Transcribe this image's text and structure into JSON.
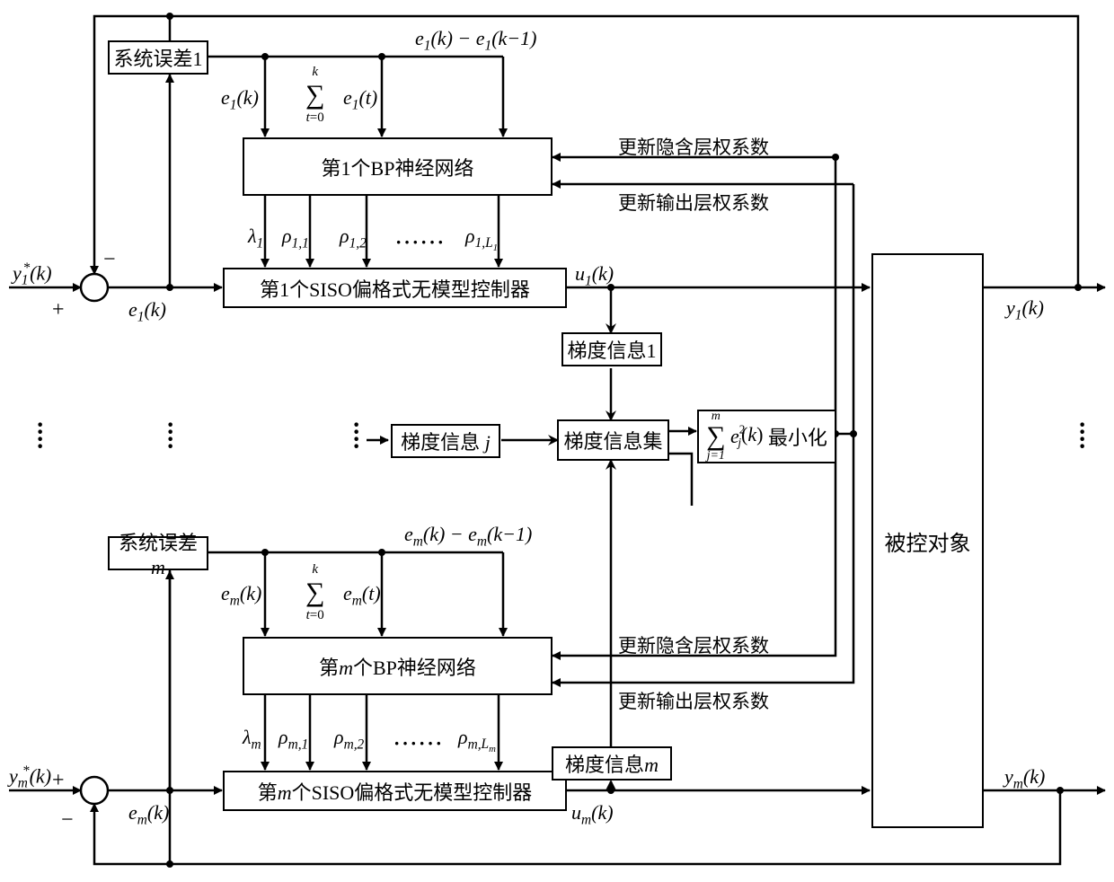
{
  "inputs": {
    "y1_ref": "y₁*(k)",
    "ym_ref": "yₘ*(k)"
  },
  "errors": {
    "e1": "e₁(k)",
    "em": "eₘ(k)"
  },
  "sys_error_1": "系统误差1",
  "sys_error_m_prefix": "系统误差",
  "sys_error_m_var": "m",
  "bp1": "第1个BP神经网络",
  "bpm_prefix": "第",
  "bpm_var": "m",
  "bpm_suffix": "个BP神经网络",
  "siso1": "第1个SISO偏格式无模型控制器",
  "sisom_prefix": "第",
  "sisom_var": "m",
  "sisom_suffix": "个SISO偏格式无模型控制器",
  "grad1": "梯度信息1",
  "gradj_prefix": "梯度信息 ",
  "gradj_var": "j",
  "gradm_prefix": "梯度信息",
  "gradm_var": "m",
  "gradset": "梯度信息集",
  "minimizer_suffix": "最小化",
  "controlled_object": "被控对象",
  "update_hidden": "更新隐含层权系数",
  "update_output": "更新输出层权系数",
  "outputs": {
    "y1": "y₁(k)",
    "ym": "yₘ(k)",
    "u1": "u₁(k)",
    "um": "uₘ(k)"
  },
  "bp_inputs_1": {
    "diff": "e₁(k) − e₁(k−1)",
    "e": "e₁(k)",
    "sum_sym": "Σ",
    "sum_top": "k",
    "sum_bot": "t=0",
    "sum_body": "e₁(t)"
  },
  "bp_inputs_m": {
    "diff": "eₘ(k) − eₘ(k−1)",
    "e": "eₘ(k)",
    "sum_top": "k",
    "sum_bot": "t=0",
    "sum_body": "eₘ(t)"
  },
  "params_1": {
    "lambda": "λ₁",
    "rho1": "ρ₁,₁",
    "rho2": "ρ₁,₂",
    "rhoL": "ρ₁,L₁"
  },
  "params_m": {
    "lambda": "λₘ",
    "rho1": "ρₘ,₁",
    "rho2": "ρₘ,₂",
    "rhoL": "ρₘ,Lₘ"
  },
  "min_sum": {
    "top": "m",
    "bot": "j=1",
    "body": "e²ⱼ(k)"
  },
  "signs": {
    "plus": "+",
    "minus": "−"
  }
}
